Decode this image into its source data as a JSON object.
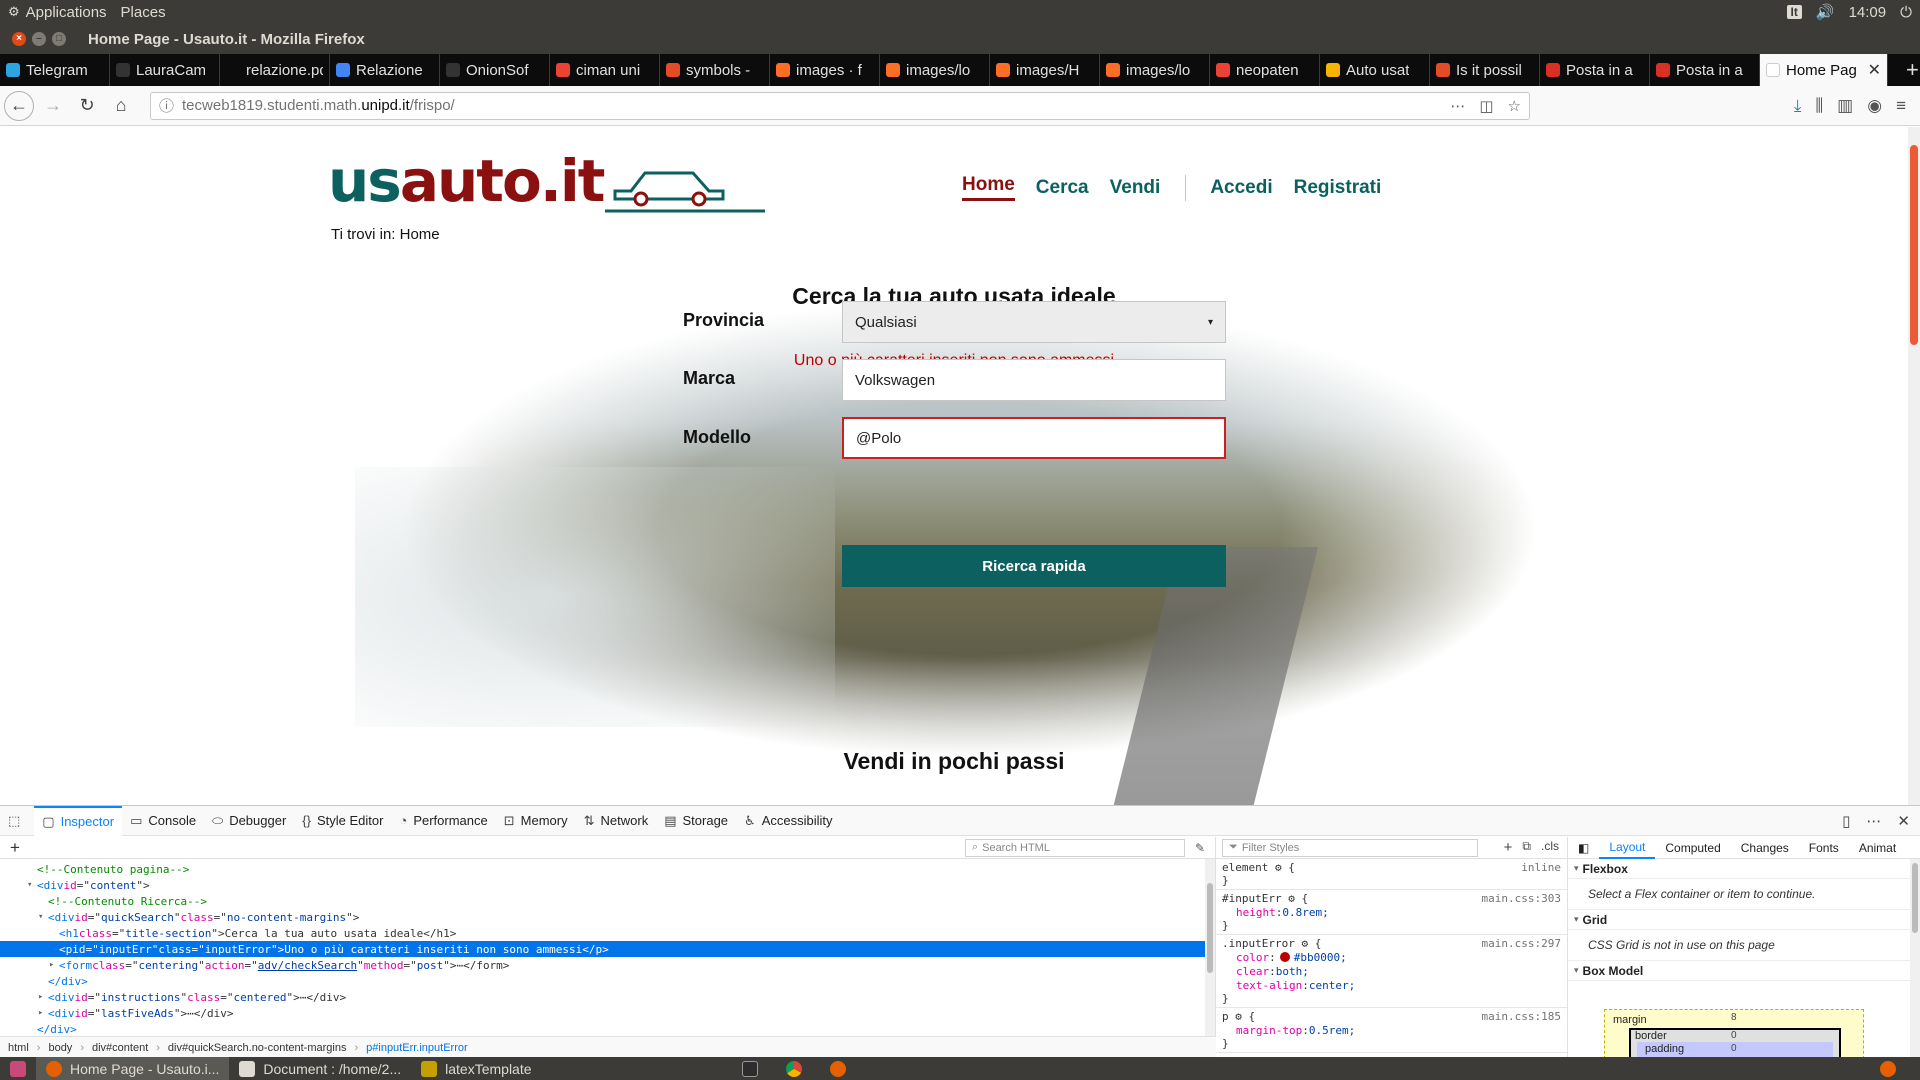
{
  "system": {
    "menus": [
      "Applications",
      "Places"
    ],
    "lang": "It",
    "volume_icon": "volume-icon",
    "clock": "14:09",
    "power_icon": "power-icon"
  },
  "window": {
    "title": "Home Page - Usauto.it - Mozilla Firefox"
  },
  "tabs": [
    {
      "label": "Telegram",
      "icon_color": "#2ca5e0"
    },
    {
      "label": "LauraCam",
      "icon_color": "#333333"
    },
    {
      "label": "relazione.pdf",
      "icon_color": "#0c0c0d"
    },
    {
      "label": "Relazione",
      "icon_color": "#4285f4"
    },
    {
      "label": "OnionSof",
      "icon_color": "#333333"
    },
    {
      "label": "ciman uni",
      "icon_color": "#ea4335"
    },
    {
      "label": "symbols -",
      "icon_color": "#e34c26"
    },
    {
      "label": "images · f",
      "icon_color": "#fc6d26"
    },
    {
      "label": "images/lo",
      "icon_color": "#fc6d26"
    },
    {
      "label": "images/H",
      "icon_color": "#fc6d26"
    },
    {
      "label": "images/lo",
      "icon_color": "#fc6d26"
    },
    {
      "label": "neopaten",
      "icon_color": "#ea4335"
    },
    {
      "label": "Auto usat",
      "icon_color": "#f4b400"
    },
    {
      "label": "Is it possil",
      "icon_color": "#e34c26"
    },
    {
      "label": "Posta in a",
      "icon_color": "#d93025"
    },
    {
      "label": "Posta in a",
      "icon_color": "#d93025"
    },
    {
      "label": "Home Pag",
      "icon_color": "#ffffff"
    }
  ],
  "urlbar": {
    "prefix": "tecweb1819.studenti.math.",
    "domain": "unipd.it",
    "path": "/frispo/"
  },
  "site": {
    "logo_us": "us",
    "logo_auto": "auto.it",
    "nav": [
      "Home",
      "Cerca",
      "Vendi"
    ],
    "nav_account": [
      "Accedi",
      "Registrati"
    ],
    "breadcrumb": "Ti trovi in: Home",
    "search_title": "Cerca la tua auto usata ideale",
    "error_text": "Uno o più caratteri inseriti non sono ammessi",
    "form": {
      "provincia_label": "Provincia",
      "provincia_value": "Qualsiasi",
      "marca_label": "Marca",
      "marca_value": "Volkswagen",
      "modello_label": "Modello",
      "modello_value": "@Polo",
      "submit_label": "Ricerca rapida"
    },
    "sell_title": "Vendi in pochi passi"
  },
  "devtools": {
    "tabs": [
      "Inspector",
      "Console",
      "Debugger",
      "Style Editor",
      "Performance",
      "Memory",
      "Network",
      "Storage",
      "Accessibility"
    ],
    "search_html_placeholder": "Search HTML",
    "filter_styles_placeholder": "Filter Styles",
    "cls_label": ".cls",
    "markup_lines": [
      {
        "indent": 1,
        "toggle": "",
        "parts": [
          {
            "c": "com",
            "t": "<!--Contenuto pagina-->"
          }
        ]
      },
      {
        "indent": 1,
        "toggle": "▾",
        "parts": [
          {
            "c": "tag",
            "t": "<div "
          },
          {
            "c": "attr",
            "t": "id"
          },
          {
            "c": "",
            "t": "=\""
          },
          {
            "c": "val",
            "t": "content"
          },
          {
            "c": "",
            "t": "\">"
          }
        ]
      },
      {
        "indent": 2,
        "toggle": "",
        "parts": [
          {
            "c": "com",
            "t": "<!--Contenuto Ricerca-->"
          }
        ]
      },
      {
        "indent": 2,
        "toggle": "▾",
        "parts": [
          {
            "c": "tag",
            "t": "<div "
          },
          {
            "c": "attr",
            "t": "id"
          },
          {
            "c": "",
            "t": "=\""
          },
          {
            "c": "val",
            "t": "quickSearch"
          },
          {
            "c": "",
            "t": "\" "
          },
          {
            "c": "attr",
            "t": "class"
          },
          {
            "c": "",
            "t": "=\""
          },
          {
            "c": "val",
            "t": "no-content-margins"
          },
          {
            "c": "",
            "t": "\">"
          }
        ]
      },
      {
        "indent": 3,
        "toggle": "",
        "parts": [
          {
            "c": "tag",
            "t": "<h1 "
          },
          {
            "c": "attr",
            "t": "class"
          },
          {
            "c": "",
            "t": "=\""
          },
          {
            "c": "val",
            "t": "title-section"
          },
          {
            "c": "",
            "t": "\">Cerca la tua auto usata ideale</h1>"
          }
        ]
      },
      {
        "indent": 3,
        "toggle": "",
        "selected": true,
        "parts": [
          {
            "c": "tag",
            "t": "<p "
          },
          {
            "c": "attr",
            "t": "id"
          },
          {
            "c": "",
            "t": "=\""
          },
          {
            "c": "val",
            "t": "inputErr"
          },
          {
            "c": "",
            "t": "\" "
          },
          {
            "c": "attr",
            "t": "class"
          },
          {
            "c": "",
            "t": "=\""
          },
          {
            "c": "val",
            "t": "inputError"
          },
          {
            "c": "",
            "t": "\">Uno o più caratteri inseriti non sono ammessi</p>"
          }
        ]
      },
      {
        "indent": 3,
        "toggle": "▸",
        "parts": [
          {
            "c": "tag",
            "t": "<form "
          },
          {
            "c": "attr",
            "t": "class"
          },
          {
            "c": "",
            "t": "=\""
          },
          {
            "c": "val",
            "t": "centering"
          },
          {
            "c": "",
            "t": "\" "
          },
          {
            "c": "attr",
            "t": "action"
          },
          {
            "c": "",
            "t": "=\""
          },
          {
            "c": "link",
            "t": "adv/checkSearch"
          },
          {
            "c": "",
            "t": "\" "
          },
          {
            "c": "attr",
            "t": "method"
          },
          {
            "c": "",
            "t": "=\""
          },
          {
            "c": "val",
            "t": "post"
          },
          {
            "c": "",
            "t": "\">⋯</form>"
          }
        ]
      },
      {
        "indent": 2,
        "toggle": "",
        "parts": [
          {
            "c": "tag",
            "t": "</div>"
          }
        ]
      },
      {
        "indent": 2,
        "toggle": "▸",
        "parts": [
          {
            "c": "tag",
            "t": "<div "
          },
          {
            "c": "attr",
            "t": "id"
          },
          {
            "c": "",
            "t": "=\""
          },
          {
            "c": "val",
            "t": "instructions"
          },
          {
            "c": "",
            "t": "\" "
          },
          {
            "c": "attr",
            "t": "class"
          },
          {
            "c": "",
            "t": "=\""
          },
          {
            "c": "val",
            "t": "centered"
          },
          {
            "c": "",
            "t": "\">⋯</div>"
          }
        ]
      },
      {
        "indent": 2,
        "toggle": "▸",
        "parts": [
          {
            "c": "tag",
            "t": "<div "
          },
          {
            "c": "attr",
            "t": "id"
          },
          {
            "c": "",
            "t": "=\""
          },
          {
            "c": "val",
            "t": "lastFiveAds"
          },
          {
            "c": "",
            "t": "\">⋯</div>"
          }
        ]
      },
      {
        "indent": 1,
        "toggle": "",
        "parts": [
          {
            "c": "tag",
            "t": "</div>"
          }
        ]
      }
    ],
    "breadcrumbs": [
      "html",
      "body",
      "div#content",
      "div#quickSearch.no-content-margins",
      "p#inputErr.inputError"
    ],
    "rules": [
      {
        "selector": "element ⚙ {",
        "source": "inline",
        "props": []
      },
      {
        "selector": "#inputErr ⚙ {",
        "source": "main.css:303",
        "props": [
          {
            "name": "height",
            "value": "0.8rem;"
          }
        ]
      },
      {
        "selector": ".inputError ⚙ {",
        "source": "main.css:297",
        "props": [
          {
            "name": "color",
            "value": "#bb0000;",
            "swatch": true
          },
          {
            "name": "clear",
            "value": "both;"
          },
          {
            "name": "text-align",
            "value": "center;"
          }
        ]
      },
      {
        "selector": "p ⚙ {",
        "source": "main.css:185",
        "props": [
          {
            "name": "margin-top",
            "value": "0.5rem;"
          }
        ]
      }
    ],
    "layout_tabs": [
      "Layout",
      "Computed",
      "Changes",
      "Fonts",
      "Animat"
    ],
    "flexbox_label": "Flexbox",
    "flexbox_msg": "Select a Flex container or item to continue.",
    "grid_label": "Grid",
    "grid_msg": "CSS Grid is not in use on this page",
    "boxmodel_label": "Box Model",
    "boxmodel": {
      "margin": "margin",
      "border": "border",
      "padding": "padding",
      "margin_val": "8",
      "border_val": "0",
      "padding_val": "0"
    }
  },
  "taskbar": {
    "items": [
      "Home Page - Usauto.i...",
      "Document : /home/2...",
      "latexTemplate"
    ]
  },
  "colors": {
    "brand_teal": "#0c6060",
    "brand_red": "#8b1010",
    "error": "#bb0000"
  }
}
